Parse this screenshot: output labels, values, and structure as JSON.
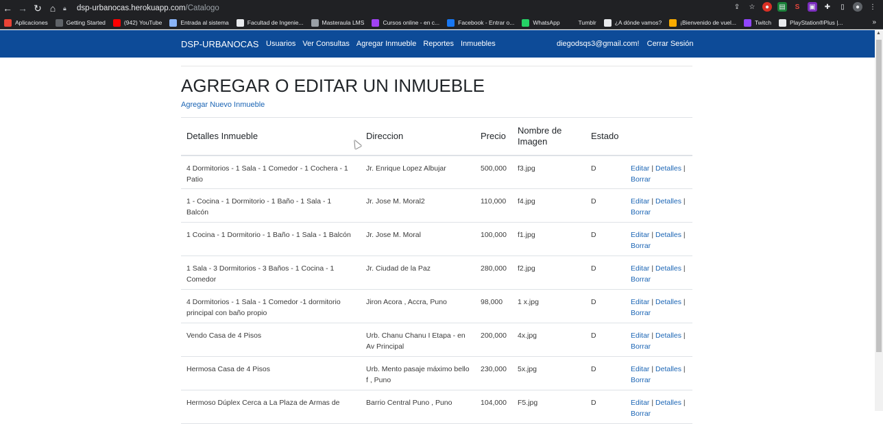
{
  "browser": {
    "url_host": "dsp-urbanocas.herokuapp.com",
    "url_path": "/Catalogo",
    "bookmarks": [
      {
        "label": "Aplicaciones",
        "icon": "apps-grid-icon",
        "color": "#ea4335"
      },
      {
        "label": "Getting Started",
        "icon": "bookmark-icon",
        "color": "#5f6368"
      },
      {
        "label": "(942) YouTube",
        "icon": "youtube-icon",
        "color": "#ff0000"
      },
      {
        "label": "Entrada al sistema",
        "icon": "page-icon",
        "color": "#8ab4f8"
      },
      {
        "label": "Facultad de Ingenie...",
        "icon": "page-icon",
        "color": "#e8eaed"
      },
      {
        "label": "Masteraula LMS",
        "icon": "globe-icon",
        "color": "#9aa0a6"
      },
      {
        "label": "Cursos online - en c...",
        "icon": "course-icon",
        "color": "#a142f4"
      },
      {
        "label": "Facebook - Entrar o...",
        "icon": "facebook-icon",
        "color": "#1877f2"
      },
      {
        "label": "WhatsApp",
        "icon": "whatsapp-icon",
        "color": "#25d366"
      },
      {
        "label": "Tumblr",
        "icon": "tumblr-icon",
        "color": "#202124"
      },
      {
        "label": "¿A dónde vamos?",
        "icon": "page-icon",
        "color": "#e8eaed"
      },
      {
        "label": "¡Bienvenido de vuel...",
        "icon": "page-icon",
        "color": "#f9ab00"
      },
      {
        "label": "Twitch",
        "icon": "twitch-icon",
        "color": "#9146ff"
      },
      {
        "label": "PlayStation®Plus |...",
        "icon": "playstation-icon",
        "color": "#e8eaed"
      }
    ]
  },
  "navbar": {
    "brand": "DSP-URBANOCAS",
    "links": [
      "Usuarios",
      "Ver Consultas",
      "Agregar Inmueble",
      "Reportes",
      "Inmuebles"
    ],
    "user_email": "diegodsqs3@gmail.com!",
    "logout": "Cerrar Sesión",
    "color": "#0d4b98"
  },
  "page": {
    "title": "AGREGAR O EDITAR UN INMUEBLE",
    "add_link": "Agregar Nuevo Inmueble"
  },
  "table": {
    "headers": [
      "Detalles Inmueble",
      "Direccion",
      "Precio",
      "Nombre de Imagen",
      "Estado",
      ""
    ],
    "actions": {
      "edit": "Editar",
      "details": "Detalles",
      "delete": "Borrar",
      "separator": "|"
    },
    "rows": [
      {
        "detalles": "4 Dormitorios - 1 Sala - 1 Comedor - 1 Cochera - 1 Patio",
        "direccion": "Jr. Enrique Lopez Albujar",
        "precio": "500,000",
        "imagen": "f3.jpg",
        "estado": "D"
      },
      {
        "detalles": "1 - Cocina - 1 Dormitorio - 1 Baño - 1 Sala - 1 Balcón",
        "direccion": "Jr. Jose M. Moral2",
        "precio": "110,000",
        "imagen": "f4.jpg",
        "estado": "D"
      },
      {
        "detalles": "1 Cocina - 1 Dormitorio - 1 Baño - 1 Sala - 1 Balcón",
        "direccion": "Jr. Jose M. Moral",
        "precio": "100,000",
        "imagen": "f1.jpg",
        "estado": "D"
      },
      {
        "detalles": "1 Sala - 3 Dormitorios - 3 Baños - 1 Cocina - 1 Comedor",
        "direccion": "Jr. Ciudad de la Paz",
        "precio": "280,000",
        "imagen": "f2.jpg",
        "estado": "D"
      },
      {
        "detalles": "4 Dormitorios - 1 Sala - 1 Comedor -1 dormitorio principal con baño propio",
        "direccion": "Jiron Acora , Accra, Puno",
        "precio": "98,000",
        "imagen": "1 x.jpg",
        "estado": "D"
      },
      {
        "detalles": "Vendo Casa de 4 Pisos",
        "direccion": "Urb. Chanu Chanu I Etapa - en Av Principal",
        "precio": "200,000",
        "imagen": "4x.jpg",
        "estado": "D"
      },
      {
        "detalles": "Hermosa Casa de 4 Pisos",
        "direccion": "Urb. Mento pasaje máximo bello f , Puno",
        "precio": "230,000",
        "imagen": "5x.jpg",
        "estado": "D"
      },
      {
        "detalles": "Hermoso Dúplex Cerca a La Plaza de Armas de",
        "direccion": "Barrio Central Puno , Puno",
        "precio": "104,000",
        "imagen": "F5.jpg",
        "estado": "D"
      }
    ]
  }
}
